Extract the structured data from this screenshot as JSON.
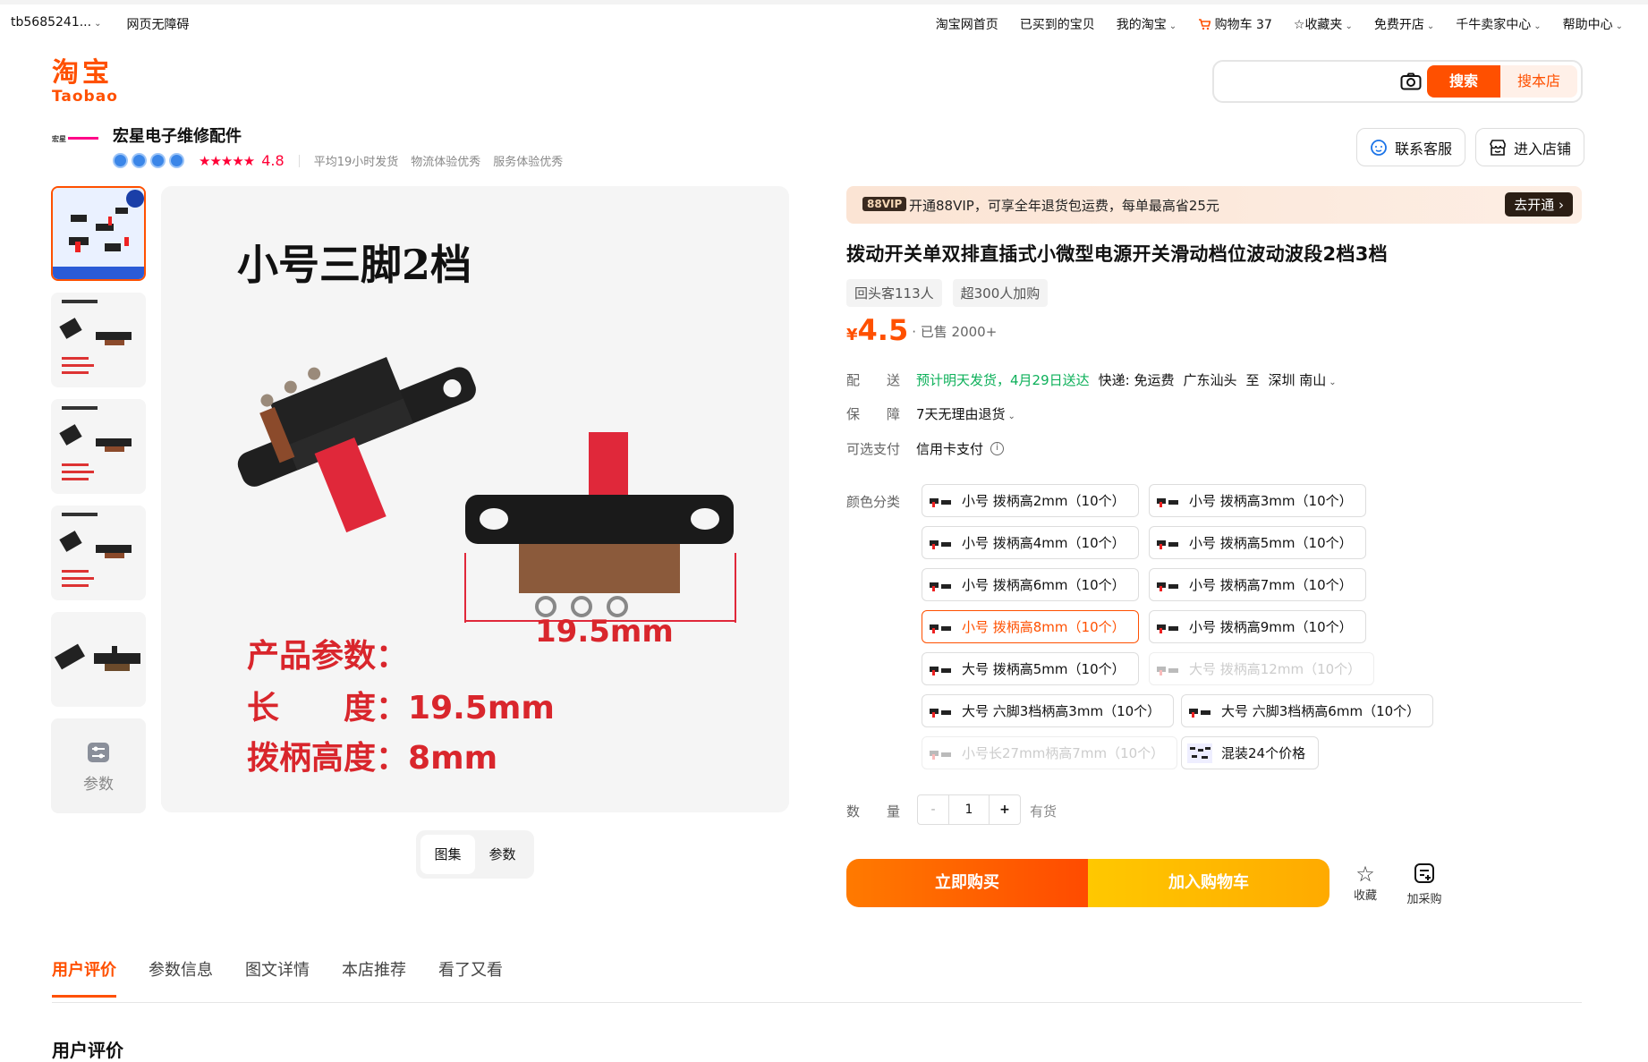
{
  "topbar": {
    "account": "tb5685241...",
    "accessibility": "网页无障碍",
    "links": [
      "淘宝网首页",
      "已买到的宝贝",
      "我的淘宝",
      "购物车 37",
      "收藏夹",
      "免费开店",
      "千牛卖家中心",
      "帮助中心"
    ]
  },
  "logo": {
    "cn": "淘宝",
    "en": "Taobao"
  },
  "search": {
    "placeholder": "",
    "btn_search": "搜索",
    "btn_shop": "搜本店"
  },
  "shop": {
    "logo_text": "宏星",
    "name": "宏星电子维修配件",
    "score": "4.8",
    "stats": [
      "平均19小时发货",
      "物流体验优秀",
      "服务体验优秀"
    ],
    "btn_service": "联系客服",
    "btn_enter": "进入店铺"
  },
  "gallery": {
    "thumb_param_label": "参数",
    "main_title": "小号三脚2档",
    "dimension": "19.5mm",
    "param_title": "产品参数：",
    "param_len_label": "长　　度：",
    "param_len_value": "19.5mm",
    "param_h_label": "拨柄高度：",
    "param_h_value": "8mm",
    "tabs": [
      "图集",
      "参数"
    ]
  },
  "vip": {
    "tag": "88VIP",
    "text": "开通88VIP，可享全年退货包运费，每单最高省25元",
    "btn": "去开通"
  },
  "product": {
    "title": "拨动开关单双排直插式小微型电源开关滑动档位波动波段2档3档",
    "tags": [
      "回头客113人",
      "超300人加购"
    ],
    "currency": "¥",
    "price": "4.5",
    "sold": "· 已售 2000+"
  },
  "delivery": {
    "label": "配　　送",
    "eta": "预计明天发货，4月29日送达",
    "shipping": "快递: 免运费",
    "from": "广东汕头",
    "to_word": "至",
    "to": "深圳 南山"
  },
  "guarantee": {
    "label": "保　　障",
    "value": "7天无理由退货"
  },
  "payment": {
    "label": "可选支付",
    "value": "信用卡支付"
  },
  "sku": {
    "label": "颜色分类",
    "options": [
      "小号 拨柄高2mm（10个）",
      "小号 拨柄高3mm（10个）",
      "小号 拨柄高4mm（10个）",
      "小号 拨柄高5mm（10个）",
      "小号 拨柄高6mm（10个）",
      "小号 拨柄高7mm（10个）",
      "小号 拨柄高8mm（10个）",
      "小号 拨柄高9mm（10个）",
      "大号 拨柄高5mm（10个）",
      "大号 拨柄高12mm（10个）",
      "大号 六脚3档柄高3mm（10个）",
      "大号 六脚3档柄高6mm（10个）",
      "小号长27mm柄高7mm（10个）",
      "混装24个价格"
    ],
    "selected": "小号 拨柄高8mm（10个）"
  },
  "quantity": {
    "label": "数　　量",
    "minus": "-",
    "value": "1",
    "plus": "+",
    "stock": "有货"
  },
  "actions": {
    "buy": "立即购买",
    "cart": "加入购物车",
    "fav": "收藏",
    "purchase": "加采购"
  },
  "tabs": [
    "用户评价",
    "参数信息",
    "图文详情",
    "本店推荐",
    "看了又看"
  ],
  "section_heading": "用户评价"
}
